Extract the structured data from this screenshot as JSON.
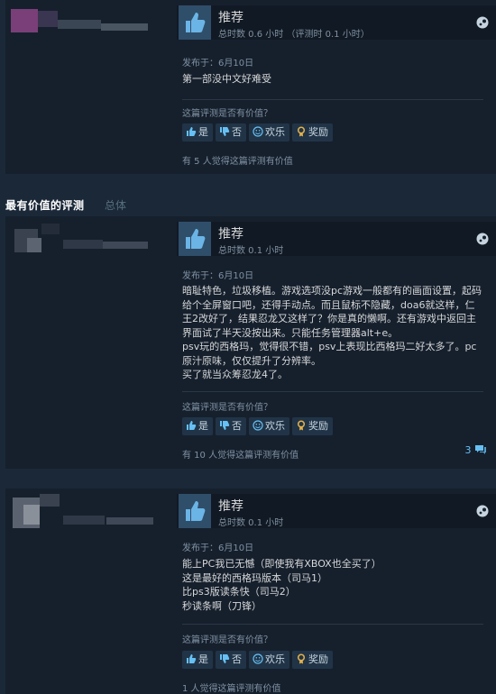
{
  "colors": {
    "background": "#1b2838",
    "card": "#16202d",
    "accent": "#66c0f4",
    "thumb": "#2f4e6a"
  },
  "section": {
    "title": "最有价值的评测",
    "tab": "总体"
  },
  "reviews": [
    {
      "rating": "推荐",
      "hours": "总时数 0.6 小时 （评测时 0.1 小时）",
      "posted": "发布于：6月10日",
      "content": [
        "第一部没中文好难受"
      ],
      "helpful_question": "这篇评测是否有价值？",
      "buttons": {
        "yes": "是",
        "no": "否",
        "funny": "欢乐",
        "award": "奖励"
      },
      "helpful_count": "有 5 人觉得这篇评测有价值",
      "comments": ""
    },
    {
      "rating": "推荐",
      "hours": "总时数 0.1 小时",
      "posted": "发布于：6月10日",
      "content": [
        "暗耻特色，垃圾移植。游戏选项没pc游戏一般都有的画面设置，起码",
        "给个全屏窗口吧，还得手动点。而且鼠标不隐藏，doa6就这样，仁",
        "王2改好了，结果忍龙又这样了？你是真的懒啊。还有游戏中返回主",
        "界面试了半天没按出来。只能任务管理器alt+e。",
        "psv玩的西格玛，觉得很不错，psv上表现比西格玛二好太多了。pc",
        "原汁原味，仅仅提升了分辨率。",
        "买了就当众筹忍龙4了。"
      ],
      "helpful_question": "这篇评测是否有价值？",
      "buttons": {
        "yes": "是",
        "no": "否",
        "funny": "欢乐",
        "award": "奖励"
      },
      "helpful_count": "有 10 人觉得这篇评测有价值",
      "comments": "3"
    },
    {
      "rating": "推荐",
      "hours": "总时数 0.1 小时",
      "posted": "发布于：6月10日",
      "content": [
        "能上PC我已无憾（即使我有XBOX也全买了）",
        "这是最好的西格玛版本（司马1）",
        "比ps3版读条快（司马2）",
        "秒读条啊（刀锋）"
      ],
      "helpful_question": "这篇评测是否有价值？",
      "buttons": {
        "yes": "是",
        "no": "否",
        "funny": "欢乐",
        "award": "奖励"
      },
      "helpful_count": "1 人觉得这篇评测有价值",
      "comments": ""
    }
  ]
}
